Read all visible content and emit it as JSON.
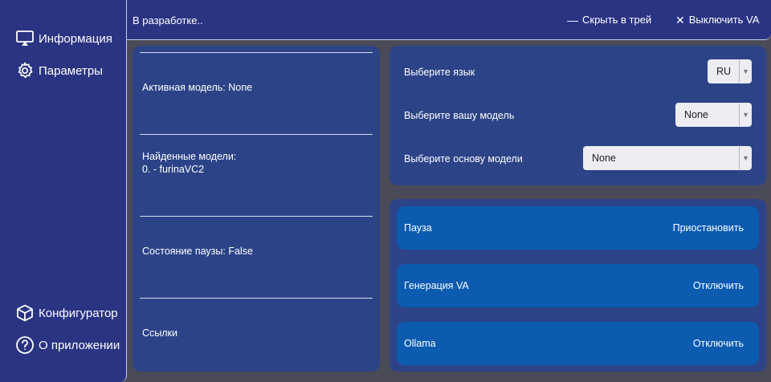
{
  "sidebar": {
    "top_items": [
      {
        "label": "Информация",
        "icon": "airplay-icon"
      },
      {
        "label": "Параметры",
        "icon": "gear-icon"
      }
    ],
    "bottom_items": [
      {
        "label": "Конфигуратор",
        "icon": "cube-icon"
      },
      {
        "label": "О приложении",
        "icon": "help-circle-icon"
      }
    ]
  },
  "topbar": {
    "status": "В разработке..",
    "minimize_label": "Скрыть в трей",
    "close_label": "Выключить VA"
  },
  "info": {
    "active_model": "Активная модель: None",
    "found_models_title": "Найденные модели:",
    "found_models_item": "0. - furinaVC2",
    "pause_state": "Состояние паузы: False",
    "links": "Ссылки"
  },
  "settings": {
    "language_label": "Выберите язык",
    "language_value": "RU",
    "model_label": "Выберите вашу модель",
    "model_value": "None",
    "base_label": "Выберите основу модели",
    "base_value": "None"
  },
  "controls": [
    {
      "label": "Пауза",
      "action": "Приостановить"
    },
    {
      "label": "Генерация VA",
      "action": "Отключить"
    },
    {
      "label": "Ollama",
      "action": "Отключить"
    }
  ],
  "colors": {
    "sidebar_bg": "#2a3483",
    "panel_bg": "#2c4388",
    "button_bg": "#0b5bb0",
    "window_bg": "#4a4a58"
  }
}
